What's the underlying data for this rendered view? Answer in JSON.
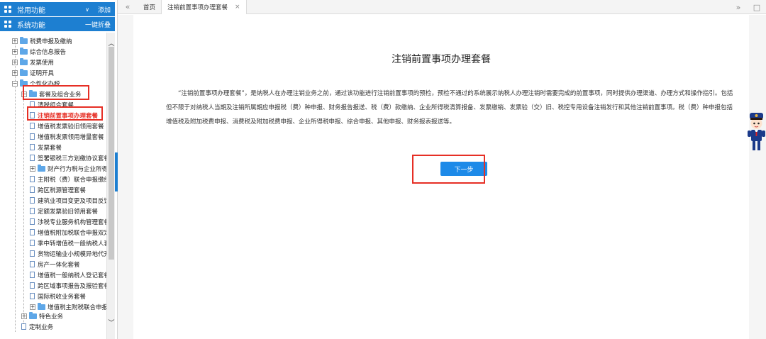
{
  "sidebar": {
    "common": {
      "title": "常用功能",
      "action": "添加"
    },
    "system": {
      "title": "系统功能",
      "action": "一键折叠"
    },
    "tree": [
      {
        "label": "税费申报及缴纳"
      },
      {
        "label": "综合信息报告"
      },
      {
        "label": "发票使用"
      },
      {
        "label": "证明开具"
      },
      {
        "label": "个性化办税"
      },
      {
        "label": "套餐及组合业务"
      },
      {
        "label": "清税组合套餐"
      },
      {
        "label": "注销前置事项办理套餐"
      },
      {
        "label": "增值税发票验旧领用套餐"
      },
      {
        "label": "增值税发票领用增量套餐"
      },
      {
        "label": "发票套餐"
      },
      {
        "label": "签署银税三方划缴协议套餐"
      },
      {
        "label": "财产行为税与企业所得税"
      },
      {
        "label": "主附税（费）联合申报缴纳"
      },
      {
        "label": "跨区税源管理套餐"
      },
      {
        "label": "建筑业项目变更及项目反馈"
      },
      {
        "label": "定额发票验旧领用套餐"
      },
      {
        "label": "涉税专业服务机构管理套餐"
      },
      {
        "label": "增值税附加税联合申报双定"
      },
      {
        "label": "季中转增值税一般纳税人套"
      },
      {
        "label": "货物运输业小规模异地代开"
      },
      {
        "label": "房产一体化套餐"
      },
      {
        "label": "增值税一般纳税人登记套餐"
      },
      {
        "label": "跨区域事项报告及报验套餐"
      },
      {
        "label": "国际税收业务套餐"
      },
      {
        "label": "增值税主附税联合申报 ε"
      },
      {
        "label": "特色业务"
      },
      {
        "label": "定制业务"
      }
    ]
  },
  "tabs": {
    "home": "首页",
    "current": "注销前置事项办理套餐",
    "close": "×"
  },
  "main": {
    "title": "注销前置事项办理套餐",
    "description": "“注销前置事项办理套餐”，是纳税人在办理注销业务之前，通过该功能进行注销前置事项的预检，预检不通过的系统展示纳税人办理注销时需要完成的前置事项，同时提供办理渠道、办理方式和操作指引。包括但不限于对纳税人当期及注销所属期应申报税（费）种申报、财务报告报送、税（费）款缴纳、企业所得税清算报备、发票缴销、发票验（交）旧、税控专用设备注销发行和其他注销前置事项。税（费）种申报包括增值税及附加税费申报、消费税及附加税费申报、企业所得税申报、综合申报、其他申报、财务报表报送等。",
    "next_label": "下一步"
  },
  "colors": {
    "accent": "#1d7fd1",
    "highlight": "#e62f25"
  },
  "icons": {
    "grid": "grid-icon",
    "folder": "folder-icon",
    "document": "document-icon"
  }
}
